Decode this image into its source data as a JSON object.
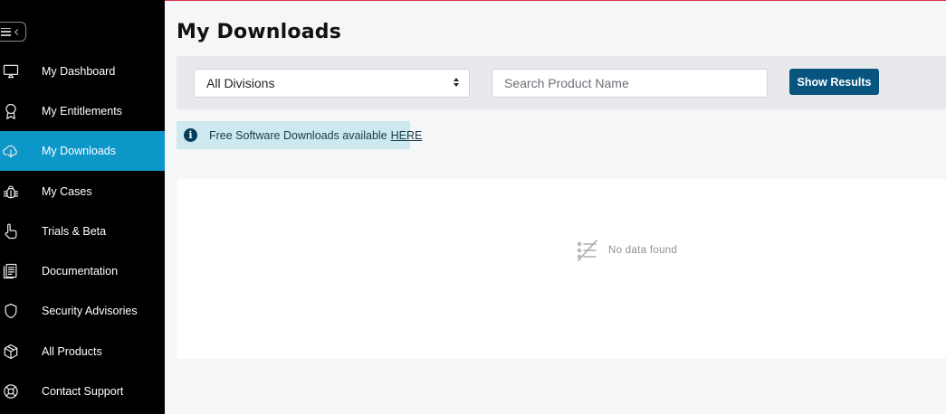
{
  "sidebar": {
    "items": [
      {
        "label": "My Dashboard",
        "icon": "monitor-icon",
        "active": false
      },
      {
        "label": "My Entitlements",
        "icon": "award-icon",
        "active": false
      },
      {
        "label": "My Downloads",
        "icon": "cloud-download-icon",
        "active": true
      },
      {
        "label": "My Cases",
        "icon": "bug-icon",
        "active": false
      },
      {
        "label": "Trials & Beta",
        "icon": "hand-pointer-icon",
        "active": false
      },
      {
        "label": "Documentation",
        "icon": "document-icon",
        "active": false
      },
      {
        "label": "Security Advisories",
        "icon": "shield-icon",
        "active": false
      },
      {
        "label": "All Products",
        "icon": "cube-icon",
        "active": false
      },
      {
        "label": "Contact Support",
        "icon": "lifebuoy-icon",
        "active": false
      }
    ]
  },
  "main": {
    "title": "My Downloads",
    "filters": {
      "division_selected": "All Divisions",
      "search_placeholder": "Search Product Name",
      "search_value": "",
      "button_label": "Show Results"
    },
    "info": {
      "text": "Free Software Downloads available",
      "link": "HERE"
    },
    "empty_state": {
      "text": "No data found",
      "icon": "no-data-icon"
    }
  },
  "colors": {
    "sidebar_bg": "#000000",
    "active_item": "#0d97c9",
    "button": "#07557e",
    "info_bg": "#cde8ee"
  }
}
